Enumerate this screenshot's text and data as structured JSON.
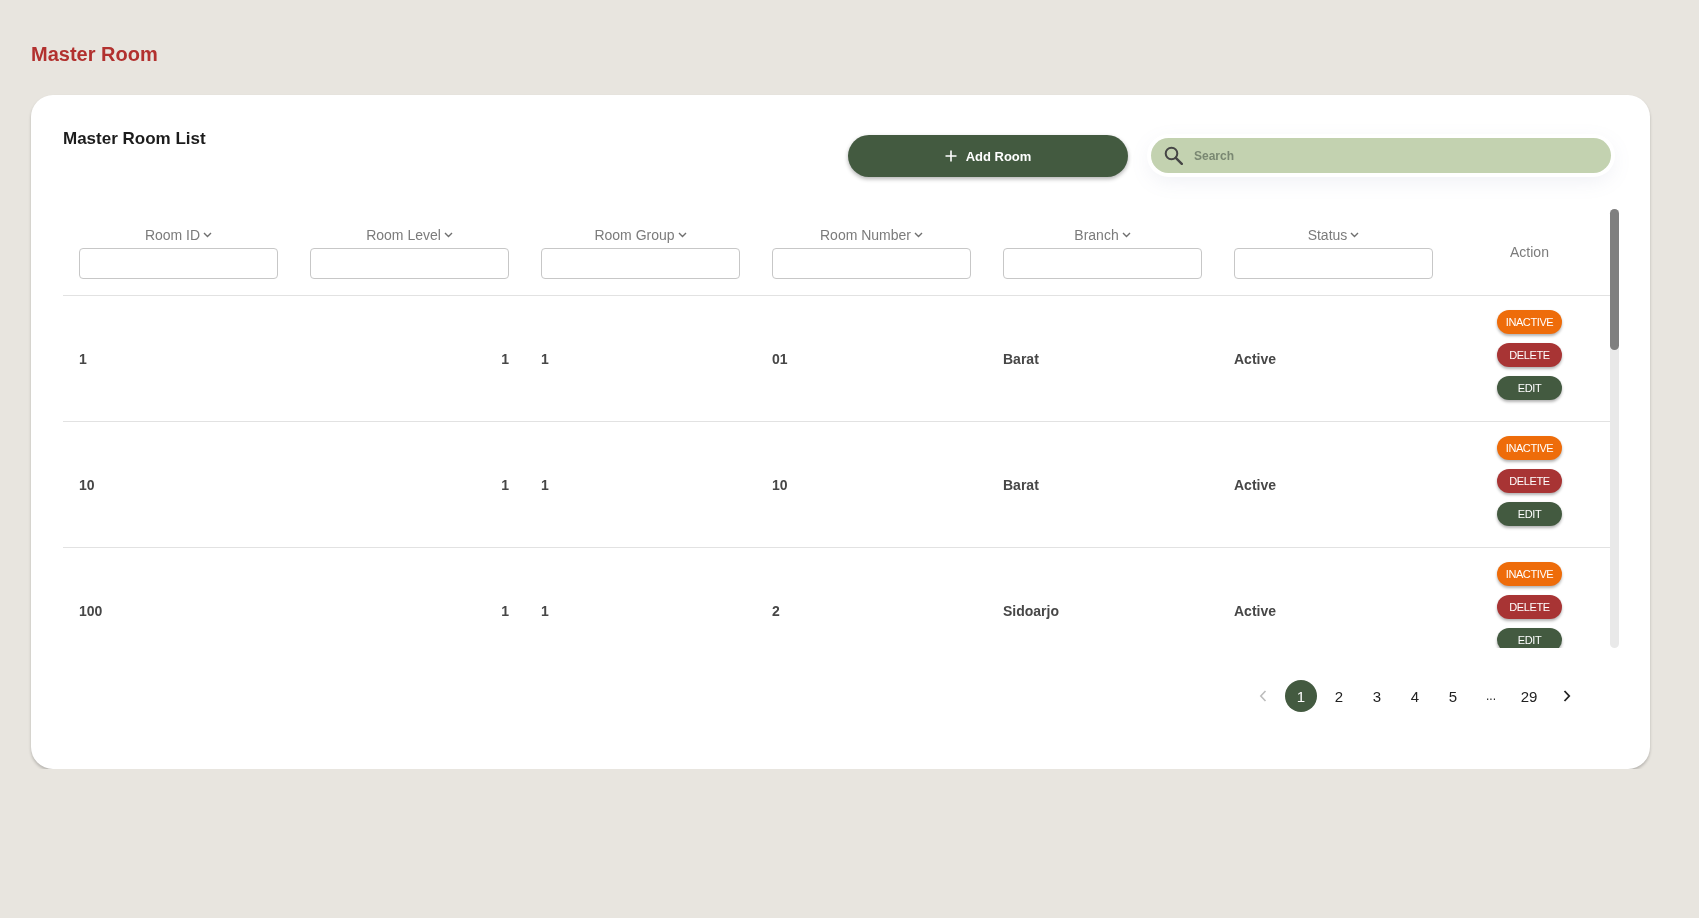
{
  "page_title": "Master Room",
  "card": {
    "title": "Master Room List",
    "add_button": {
      "label": "Add Room"
    },
    "search": {
      "placeholder": "Search"
    }
  },
  "table": {
    "columns": [
      {
        "label": "Room ID",
        "kind": "text",
        "sortable": true,
        "filter": true
      },
      {
        "label": "Room Level",
        "kind": "number",
        "sortable": true,
        "filter": true
      },
      {
        "label": "Room Group",
        "kind": "text",
        "sortable": true,
        "filter": true
      },
      {
        "label": "Room Number",
        "kind": "text",
        "sortable": true,
        "filter": true
      },
      {
        "label": "Branch",
        "kind": "text",
        "sortable": true,
        "filter": true
      },
      {
        "label": "Status",
        "kind": "text",
        "sortable": true,
        "filter": true
      },
      {
        "label": "Action",
        "kind": "actions",
        "sortable": false,
        "filter": false
      }
    ],
    "rows": [
      {
        "cells": [
          "1",
          "1",
          "1",
          "01",
          "Barat",
          "Active"
        ],
        "actions": [
          {
            "kind": "inactive",
            "label": "INACTIVE"
          },
          {
            "kind": "delete",
            "label": "DELETE"
          },
          {
            "kind": "edit",
            "label": "EDIT"
          }
        ]
      },
      {
        "cells": [
          "10",
          "1",
          "1",
          "10",
          "Barat",
          "Active"
        ],
        "actions": [
          {
            "kind": "inactive",
            "label": "INACTIVE"
          },
          {
            "kind": "delete",
            "label": "DELETE"
          },
          {
            "kind": "edit",
            "label": "EDIT"
          }
        ]
      },
      {
        "cells": [
          "100",
          "1",
          "1",
          "2",
          "Sidoarjo",
          "Active"
        ],
        "actions": [
          {
            "kind": "inactive",
            "label": "INACTIVE"
          },
          {
            "kind": "delete",
            "label": "DELETE"
          },
          {
            "kind": "edit",
            "label": "EDIT"
          }
        ]
      }
    ]
  },
  "pagination": {
    "previous": {
      "disabled": true
    },
    "next": {
      "disabled": false
    },
    "items": [
      {
        "kind": "page",
        "label": "1",
        "selected": true
      },
      {
        "kind": "page",
        "label": "2",
        "selected": false
      },
      {
        "kind": "page",
        "label": "3",
        "selected": false
      },
      {
        "kind": "page",
        "label": "4",
        "selected": false
      },
      {
        "kind": "page",
        "label": "5",
        "selected": false
      },
      {
        "kind": "gap",
        "label": "...",
        "selected": false
      },
      {
        "kind": "page",
        "label": "29",
        "selected": false
      }
    ]
  }
}
